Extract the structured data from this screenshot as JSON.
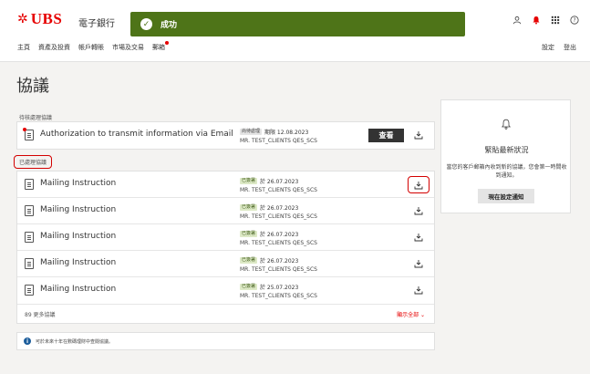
{
  "header": {
    "logo_text": "UBS",
    "app_name": "電子銀行",
    "toast": "成功",
    "nav": [
      "主頁",
      "資產及投資",
      "帳戶轉賬",
      "市場及交易",
      "郵箱"
    ],
    "settings": "設定",
    "logout": "登出"
  },
  "page_title": "協議",
  "pending_section": {
    "label": "待核處理協議",
    "item": {
      "title": "Authorization to transmit information via Email",
      "status": "尚待處理",
      "date": "期限 12.08.2023",
      "client": "MR. TEST_CLIENTS QES_SCS",
      "view_label": "查看"
    }
  },
  "processed_section": {
    "label": "已處理協議",
    "items": [
      {
        "title": "Mailing Instruction",
        "status": "已簽署",
        "date": "於 26.07.2023",
        "client": "MR. TEST_CLIENTS QES_SCS"
      },
      {
        "title": "Mailing Instruction",
        "status": "已簽署",
        "date": "於 26.07.2023",
        "client": "MR. TEST_CLIENTS QES_SCS"
      },
      {
        "title": "Mailing Instruction",
        "status": "已簽署",
        "date": "於 26.07.2023",
        "client": "MR. TEST_CLIENTS QES_SCS"
      },
      {
        "title": "Mailing Instruction",
        "status": "已簽署",
        "date": "於 26.07.2023",
        "client": "MR. TEST_CLIENTS QES_SCS"
      },
      {
        "title": "Mailing Instruction",
        "status": "已簽署",
        "date": "於 25.07.2023",
        "client": "MR. TEST_CLIENTS QES_SCS"
      }
    ],
    "more": "89 更多協議",
    "show_all": "顯示全部 ⌄"
  },
  "info": "可於未來十年在數碼理財中查閱協議。",
  "side_panel": {
    "title": "緊貼最新狀況",
    "desc": "當您的客戶郵箱內收到新的協議，您會第一時間收到通知。",
    "button": "現在設定通知"
  },
  "colors": {
    "brand": "#e60000",
    "toast": "#4e7418",
    "dark_button": "#333333",
    "signed_badge": "#dde9c6"
  }
}
